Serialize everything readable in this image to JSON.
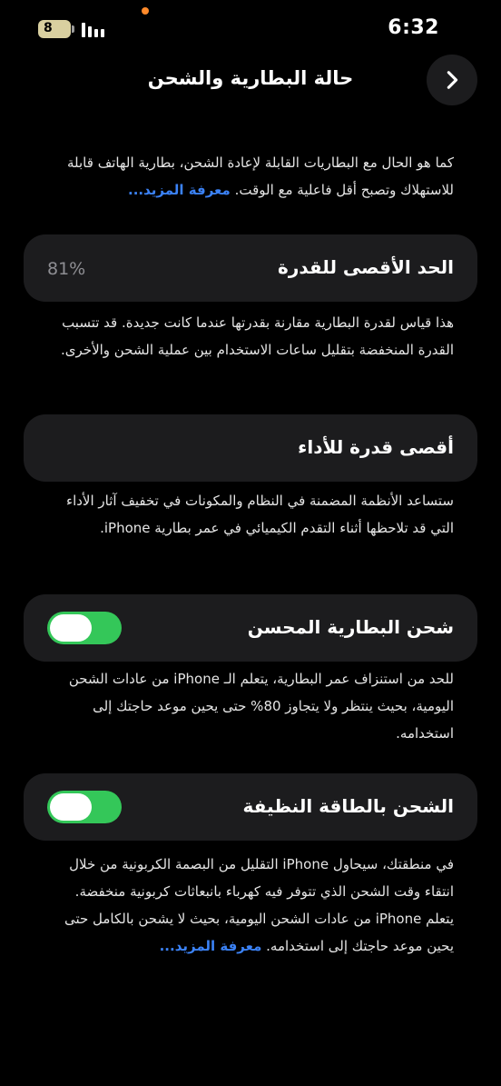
{
  "status_bar": {
    "time": "6:32",
    "battery_level": "8",
    "battery_icon": "battery-icon",
    "signal_icon": "cellular-signal-icon"
  },
  "header": {
    "title": "حالة البطارية والشحن",
    "back_icon": "chevron-right-icon"
  },
  "intro": {
    "text": "كما هو الحال مع البطاريات القابلة لإعادة الشحن، بطارية الهاتف قابلة للاستهلاك وتصبح أقل فاعلية مع الوقت.",
    "link": "معرفة المزيد..."
  },
  "max_capacity": {
    "label": "الحد الأقصى للقدرة",
    "value": "81%",
    "description": "هذا قياس لقدرة البطارية مقارنة بقدرتها عندما كانت جديدة. قد تتسبب القدرة المنخفضة بتقليل ساعات الاستخدام بين عملية الشحن والأخرى."
  },
  "peak_performance": {
    "label": "أقصى قدرة للأداء",
    "description": "ستساعد الأنظمة المضمنة في النظام والمكونات في تخفيف آثار الأداء التي قد تلاحظها أثناء التقدم الكيميائي في عمر بطارية iPhone."
  },
  "optimized_charging": {
    "label": "شحن البطارية المحسن",
    "enabled": true,
    "description": "للحد من استنزاف عمر البطارية، يتعلم الـ iPhone من عادات الشحن اليومية، بحيث ينتظر ولا يتجاوز 80% حتى يحين موعد حاجتك إلى استخدامه."
  },
  "clean_energy_charging": {
    "label": "الشحن بالطاقة النظيفة",
    "enabled": true,
    "description": "في منطقتك، سيحاول iPhone التقليل من البصمة الكربونية من خلال انتقاء وقت الشحن الذي تتوفر فيه كهرباء بانبعاثات كربونية منخفضة. يتعلم iPhone من عادات الشحن اليومية، بحيث لا يشحن بالكامل حتى يحين موعد حاجتك إلى استخدامه.",
    "link": "معرفة المزيد..."
  },
  "colors": {
    "background": "#000000",
    "card": "#1c1c1e",
    "toggle_on": "#34c759",
    "link": "#3b82f6"
  }
}
